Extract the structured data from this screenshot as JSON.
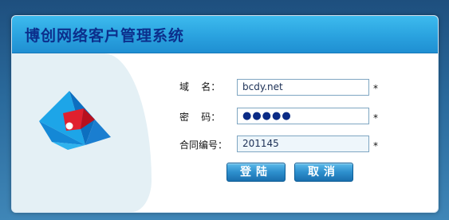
{
  "title": "博创网络客户管理系统",
  "form": {
    "domain_label": "域    名：",
    "domain_value": "bcdy.net",
    "password_label": "密    码：",
    "password_value": "●●●●●",
    "contract_label": "合同编号：",
    "contract_value": "201145",
    "required_mark": "*"
  },
  "buttons": {
    "login": "登陆",
    "cancel": "取消"
  }
}
